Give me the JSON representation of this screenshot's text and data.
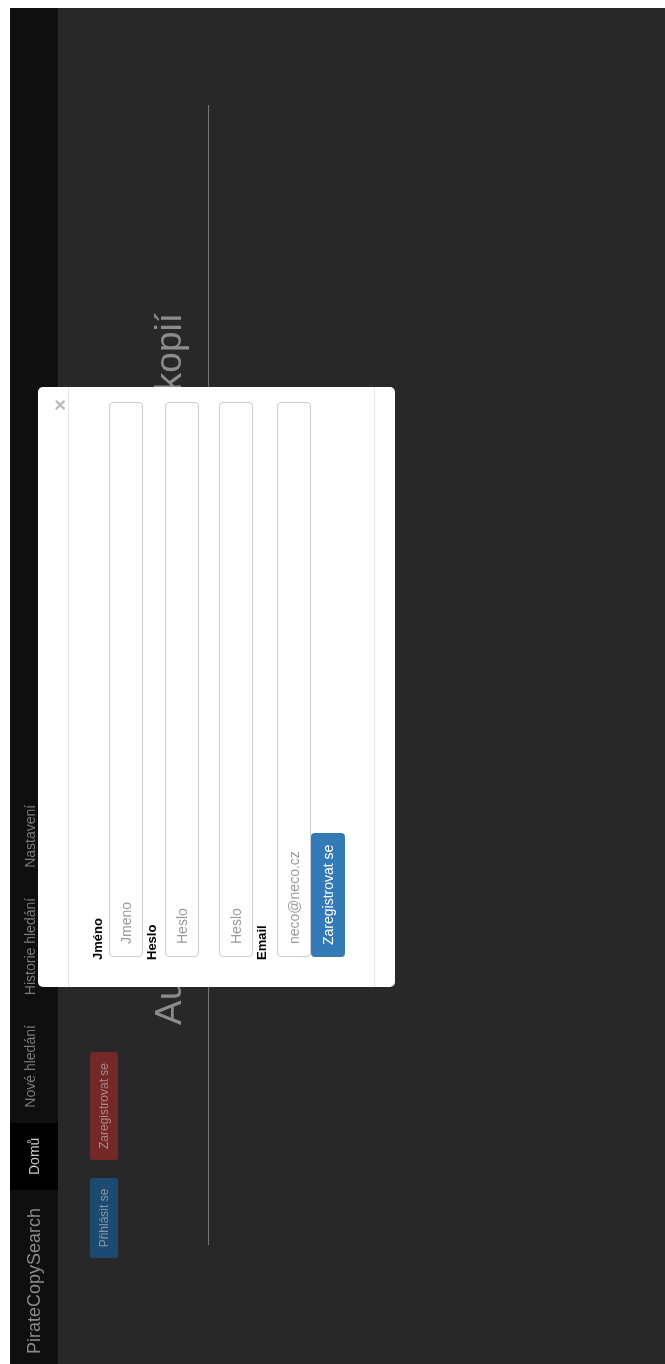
{
  "navbar": {
    "brand": "PirateCopySearch",
    "items": [
      {
        "label": "Domů",
        "selected": true
      },
      {
        "label": "Nové hledání",
        "selected": false
      },
      {
        "label": "Historie hledání",
        "selected": false
      },
      {
        "label": "Nastavení",
        "selected": false
      }
    ]
  },
  "buttons": [
    {
      "label": "Přihlásit se",
      "kind": "login"
    },
    {
      "label": "Zaregistrovat se",
      "kind": "register"
    }
  ],
  "heading_parts": [
    "Au",
    "kopií"
  ],
  "modal": {
    "close": "×",
    "fields": [
      {
        "label": "Jméno",
        "placeholder": "Jmeno"
      },
      {
        "label": "Heslo",
        "placeholder": "Heslo"
      },
      {
        "placeholder": "Heslo"
      },
      {
        "label": "Email",
        "placeholder": "neco@neco.cz"
      }
    ],
    "submit": "Zaregistrovat se"
  }
}
